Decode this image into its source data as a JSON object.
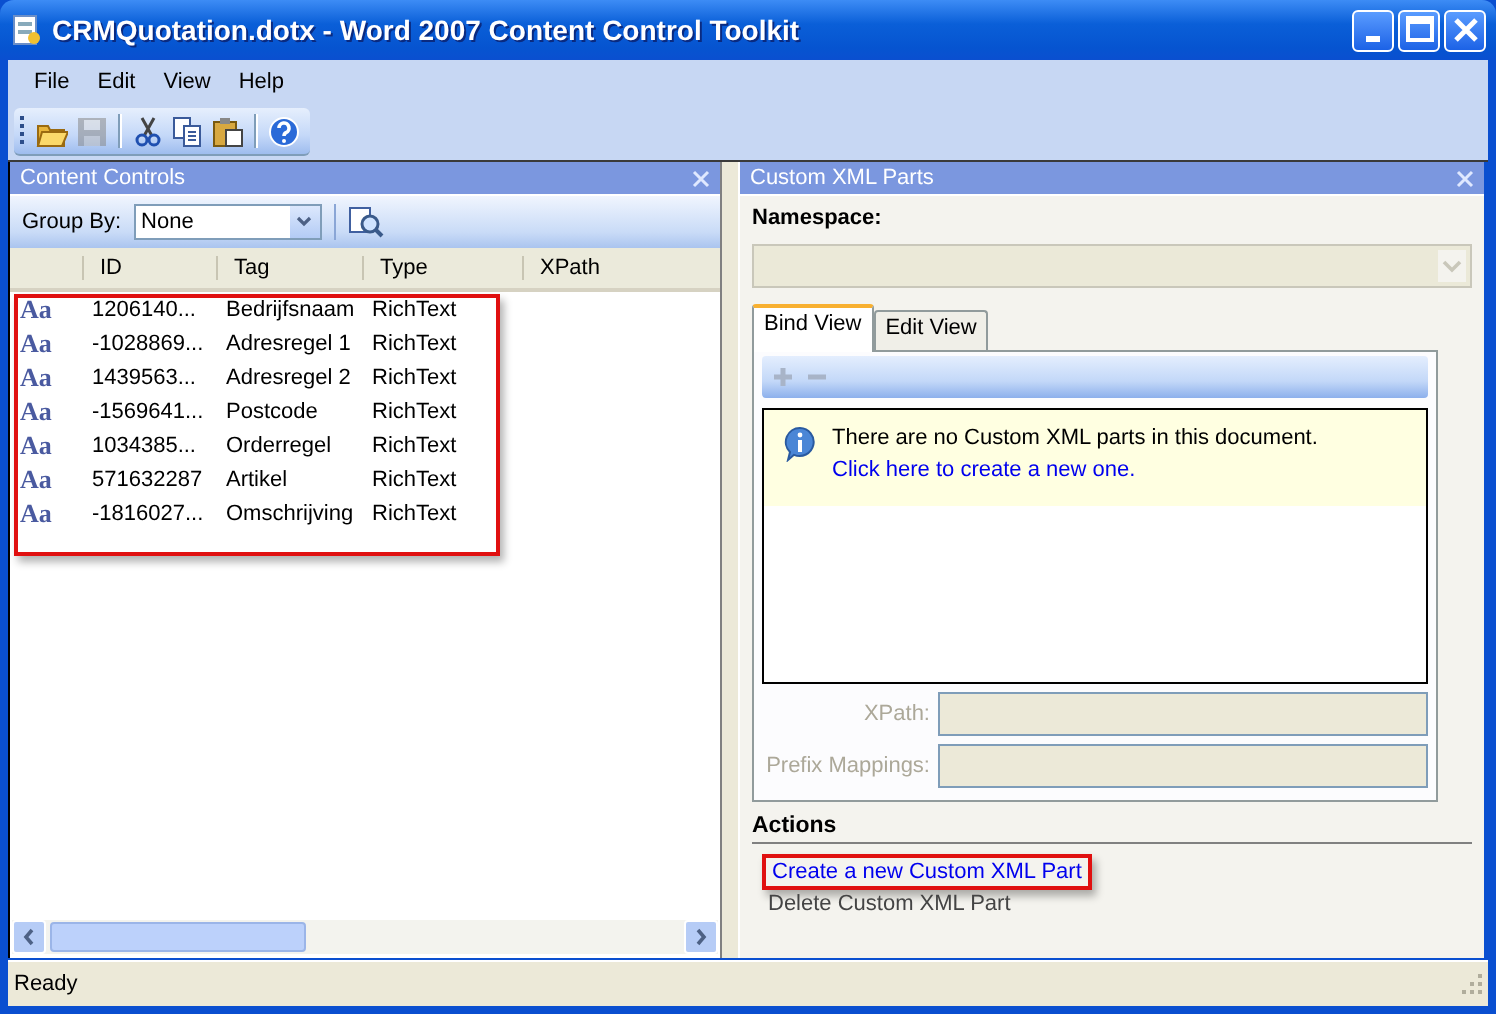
{
  "window": {
    "title": "CRMQuotation.dotx - Word 2007 Content Control Toolkit"
  },
  "menu": [
    "File",
    "Edit",
    "View",
    "Help"
  ],
  "toolbar": [
    {
      "kind": "open",
      "disabled": false
    },
    {
      "kind": "save",
      "disabled": true
    },
    {
      "kind": "cut",
      "disabled": false
    },
    {
      "kind": "copy",
      "disabled": false
    },
    {
      "kind": "paste",
      "disabled": false
    },
    {
      "kind": "help",
      "disabled": false
    }
  ],
  "content_controls": {
    "title": "Content Controls",
    "group_by_label": "Group By:",
    "group_by_value": "None",
    "columns": [
      "ID",
      "Tag",
      "Type",
      "XPath"
    ],
    "rows": [
      {
        "glyph": "Aa",
        "id": "1206140...",
        "tag": "Bedrijfsnaam",
        "type": "RichText"
      },
      {
        "glyph": "Aa",
        "id": "-1028869...",
        "tag": "Adresregel 1",
        "type": "RichText"
      },
      {
        "glyph": "Aa",
        "id": "1439563...",
        "tag": "Adresregel 2",
        "type": "RichText"
      },
      {
        "glyph": "Aa",
        "id": "-1569641...",
        "tag": "Postcode",
        "type": "RichText"
      },
      {
        "glyph": "Aa",
        "id": "1034385...",
        "tag": "Orderregel",
        "type": "RichText"
      },
      {
        "glyph": "Aa",
        "id": "571632287",
        "tag": "Artikel",
        "type": "RichText"
      },
      {
        "glyph": "Aa",
        "id": "-1816027...",
        "tag": "Omschrijving",
        "type": "RichText"
      }
    ]
  },
  "xml_parts": {
    "title": "Custom XML Parts",
    "namespace_label": "Namespace:",
    "tabs": [
      {
        "label": "Bind View",
        "selected": true
      },
      {
        "label": "Edit View",
        "selected": false
      }
    ],
    "message": "There are no Custom XML parts in this document.",
    "message_link": "Click here to create a new one.",
    "fields": [
      {
        "label": "XPath:",
        "disabled": true
      },
      {
        "label": "Prefix Mappings:",
        "disabled": true
      }
    ],
    "actions_title": "Actions",
    "actions": [
      {
        "label": "Create a new Custom XML Part",
        "disabled": false,
        "highlighted": true
      },
      {
        "label": "Delete Custom XML Part",
        "disabled": true,
        "highlighted": false
      }
    ]
  },
  "status_bar": "Ready"
}
